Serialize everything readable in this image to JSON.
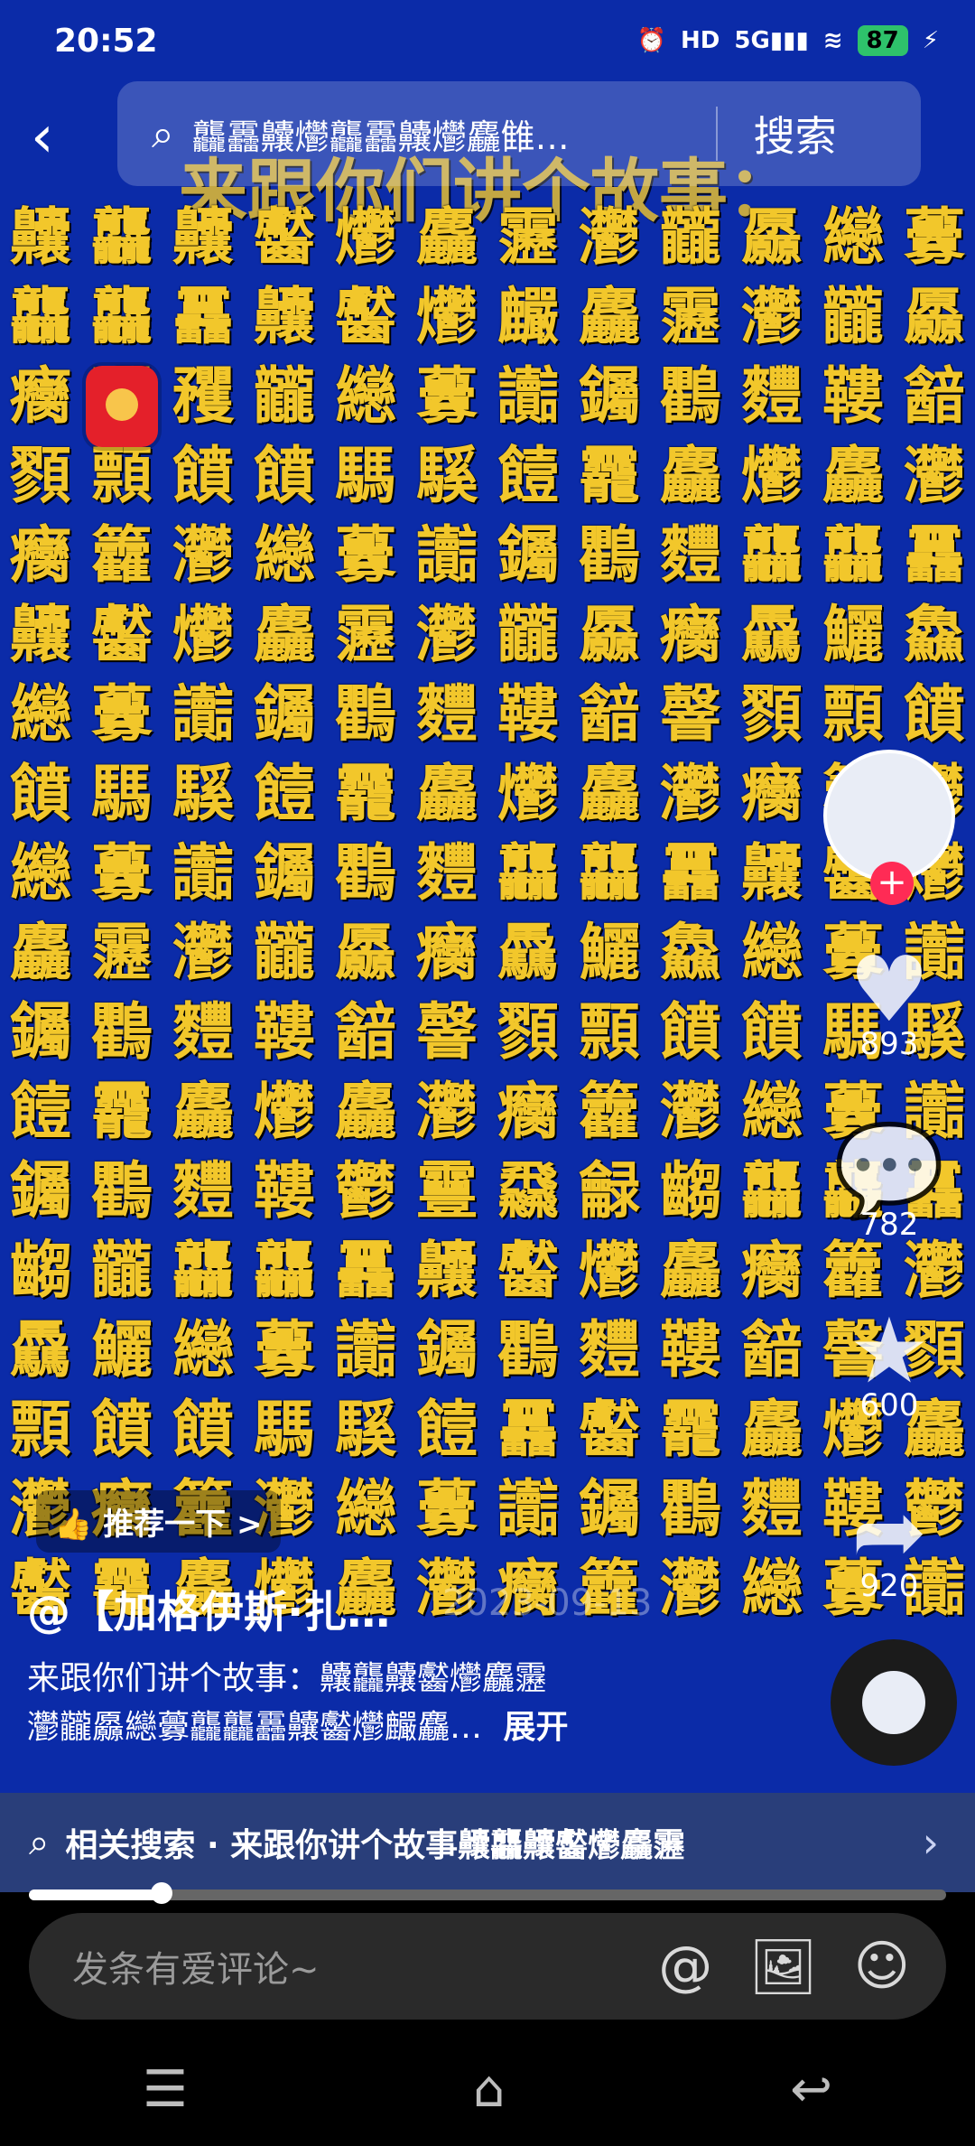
{
  "status": {
    "time": "20:52",
    "icons": [
      "alarm-icon",
      "hd-icon",
      "5g-signal-icon",
      "wifi-icon",
      "battery-icon",
      "charging-icon"
    ],
    "battery": "87"
  },
  "search": {
    "back_icon": "back-icon",
    "search_icon": "search-icon",
    "query": "龘靐齉爩龘靐齉爩麤雔…",
    "button": "搜索"
  },
  "video": {
    "headline": "来跟你们讲个故事：",
    "glyph_rows": [
      "齉龘齉齾爩麤靋灪龖厵纞虋",
      "龘龘靐齉齾爩麣麤靋灪龖厵",
      "癵矡矡龖纞虋讟钃鸜麷鞻韽韾",
      "顟顠饙饙騳騱饐龗麤爩麤灪",
      "癵籱灪纞虋讟钃鸜麷龘龘靐",
      "齉齾爩麤靋灪龖厵癵驫鱺鱻",
      "纞虋讟钃鸜麷鞻韽韾顟顠饙",
      "饙騳騱饐龗麤爩麤灪癵籱灪",
      "纞虋讟钃鸜麷龘龘靐齉齾爩",
      "麤靋灪龖厵癵驫鱺鱻纞虋讟",
      "钃鸜麷鞻韽韾顟顠饙饙騳騱",
      "饐龗麤爩麤灪癵籱灪纞虋讟",
      "钃鸜麷鞻鬱靊飝龣齺龘龘靐",
      "齺龖龘龘靐齉齾爩麤癵籱灪",
      "驫鱺纞虋讟钃鸜麷鞻韽韾顟",
      "顠饙饙騳騱饐靐齾龗麤爩麤",
      "灪癵籱灪纞虋讟钃鸜麷鞻鬱",
      "齾龗麤爩麤灪癵籱灪纞虋讟"
    ]
  },
  "rail": {
    "avatar_icon": "avatar-icon",
    "follow_icon": "plus-icon",
    "like_icon": "heart-icon",
    "like_count": "893",
    "comment_icon": "comment-icon",
    "comment_count": "782",
    "favorite_icon": "star-icon",
    "favorite_count": "600",
    "share_icon": "share-icon",
    "share_count": "920",
    "disc_icon": "music-disc-icon"
  },
  "post": {
    "recommend": "推荐一下 >",
    "author": "@【加格伊斯·扎…",
    "date": "2023-09-13",
    "description_line1": "来跟你们讲个故事：齉龘齉齾爩麤靋",
    "description_line2": "灪龖厵纞虋龘龘靐齉齾爩麣麤…",
    "more": "展开"
  },
  "related": {
    "label": "相关搜索 · 来跟你讲个故事齉龘齉齾爩麤靋"
  },
  "progress": {
    "value": 0.145
  },
  "comment": {
    "placeholder": "发条有爱评论~",
    "icons": [
      "at-icon",
      "image-icon",
      "emoji-icon"
    ]
  },
  "nav": {
    "icons": [
      "menu-icon",
      "home-icon",
      "back-nav-icon"
    ]
  }
}
